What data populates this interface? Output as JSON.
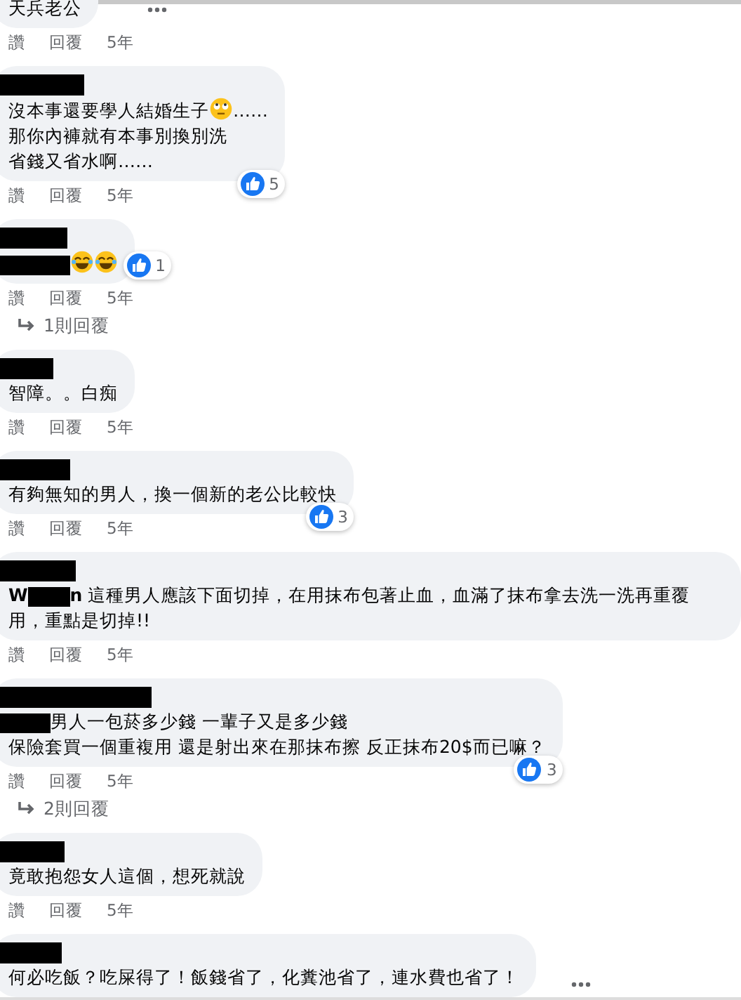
{
  "comments": [
    {
      "author_redacted": false,
      "more_menu": true,
      "parts": [
        {
          "kind": "text",
          "text": "天兵老公"
        }
      ],
      "actions": [
        "讚",
        "回覆",
        "5年"
      ]
    },
    {
      "author_redacted": true,
      "more_menu": false,
      "parts": [
        {
          "kind": "text",
          "text": "沒本事還要學人結婚生子"
        },
        {
          "kind": "rolling-eyes"
        },
        {
          "kind": "text",
          "text": "……"
        },
        {
          "kind": "break"
        },
        {
          "kind": "text",
          "text": "那你內褲就有本事別換別洗"
        },
        {
          "kind": "break"
        },
        {
          "kind": "text",
          "text": "省錢又省水啊……"
        }
      ],
      "likes": "5",
      "actions": [
        "讚",
        "回覆",
        "5年"
      ]
    },
    {
      "author_redacted": true,
      "more_menu": false,
      "badge_side": true,
      "parts": [
        {
          "kind": "redaction"
        },
        {
          "kind": "laughing"
        },
        {
          "kind": "laughing"
        }
      ],
      "likes": "1",
      "actions": [
        "讚",
        "回覆",
        "5年"
      ],
      "replies": "1則回覆"
    },
    {
      "author_redacted": true,
      "more_menu": false,
      "parts": [
        {
          "kind": "text",
          "text": "智障。。白痴"
        }
      ],
      "actions": [
        "讚",
        "回覆",
        "5年"
      ]
    },
    {
      "author_redacted": true,
      "more_menu": false,
      "parts": [
        {
          "kind": "text",
          "text": "有夠無知的男人，換一個新的老公比較快"
        }
      ],
      "likes": "3",
      "actions": [
        "讚",
        "回覆",
        "5年"
      ]
    },
    {
      "author_redacted": true,
      "more_menu": false,
      "parts": [
        {
          "kind": "mention",
          "text": "W"
        },
        {
          "kind": "redaction"
        },
        {
          "kind": "mention",
          "text": "n"
        },
        {
          "kind": "text",
          "text": " 這種男人應該下面切掉，在用抹布包著止血，血滿了抹布拿去洗一洗再重覆用，重點是切掉!!"
        }
      ],
      "actions": [
        "讚",
        "回覆",
        "5年"
      ]
    },
    {
      "author_redacted": true,
      "more_menu": false,
      "parts": [
        {
          "kind": "redaction"
        },
        {
          "kind": "text",
          "text": "男人一包菸多少錢 一輩子又是多少錢"
        },
        {
          "kind": "break"
        },
        {
          "kind": "text",
          "text": "保險套買一個重複用 還是射出來在那抹布擦 反正抹布20$而已嘛？"
        }
      ],
      "likes": "3",
      "actions": [
        "讚",
        "回覆",
        "5年"
      ],
      "replies": "2則回覆"
    },
    {
      "author_redacted": true,
      "more_menu": false,
      "parts": [
        {
          "kind": "text",
          "text": "竟敢抱怨女人這個，想死就說"
        }
      ],
      "actions": [
        "讚",
        "回覆",
        "5年"
      ]
    },
    {
      "author_redacted": true,
      "more_menu": true,
      "parts": [
        {
          "kind": "text",
          "text": "何必吃飯？吃屎得了！飯錢省了，化糞池省了，連水費也省了！"
        }
      ]
    }
  ]
}
